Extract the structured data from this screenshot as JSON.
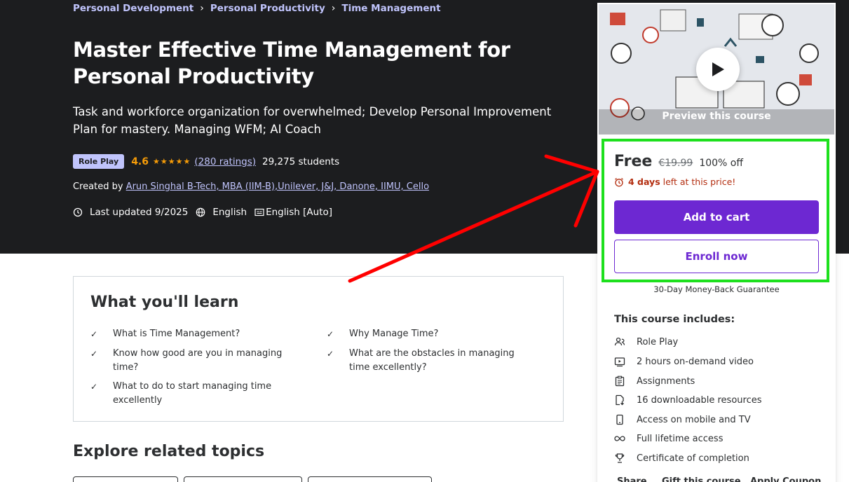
{
  "breadcrumb": [
    "Personal Development",
    "Personal Productivity",
    "Time Management"
  ],
  "course": {
    "title": "Master Effective Time Management for Personal Productivity",
    "subtitle": "Task and workforce organization for overwhelmed; Develop Personal Improvement Plan for mastery. Managing WFM; AI Coach",
    "badge": "Role Play",
    "rating": "4.6",
    "rating_value": 4.6,
    "ratings_count": "(280 ratings)",
    "students": "29,275 students",
    "created_by_label": "Created by",
    "author": "Arun Singhal B-Tech, MBA (IIM-B),Unilever, J&J, Danone, IIMU, Cello",
    "last_updated": "Last updated 9/2025",
    "language": "English",
    "captions": "English [Auto]"
  },
  "learn": {
    "heading": "What you'll learn",
    "items": [
      "What is Time Management?",
      "Why Manage Time?",
      "Know how good are you in managing time?",
      "What are the obstacles in managing time excellently?",
      "What to do to start managing time excellently"
    ]
  },
  "explore": {
    "heading": "Explore related topics"
  },
  "sidebar": {
    "preview_caption": "Preview this course",
    "price": "Free",
    "original_price": "€19.99",
    "discount": "100% off",
    "timer_bold": "4 days",
    "timer_rest": "left at this price!",
    "add_to_cart": "Add to cart",
    "enroll": "Enroll now",
    "guarantee": "30-Day Money-Back Guarantee",
    "includes_title": "This course includes:",
    "includes": [
      {
        "icon": "role-play-icon",
        "label": "Role Play"
      },
      {
        "icon": "video-icon",
        "label": "2 hours on-demand video"
      },
      {
        "icon": "assignment-icon",
        "label": "Assignments"
      },
      {
        "icon": "download-icon",
        "label": "16 downloadable resources"
      },
      {
        "icon": "mobile-icon",
        "label": "Access on mobile and TV"
      },
      {
        "icon": "infinity-icon",
        "label": "Full lifetime access"
      },
      {
        "icon": "trophy-icon",
        "label": "Certificate of completion"
      }
    ],
    "footer": [
      "Share",
      "Gift this course",
      "Apply Coupon"
    ]
  },
  "colors": {
    "hero_bg": "#1c1d1f",
    "link": "#c0c4fc",
    "star": "#f69c08",
    "primary": "#6d28d2",
    "timer": "#b32d0f",
    "highlight": "#1de01d",
    "arrow": "#ff0000"
  }
}
